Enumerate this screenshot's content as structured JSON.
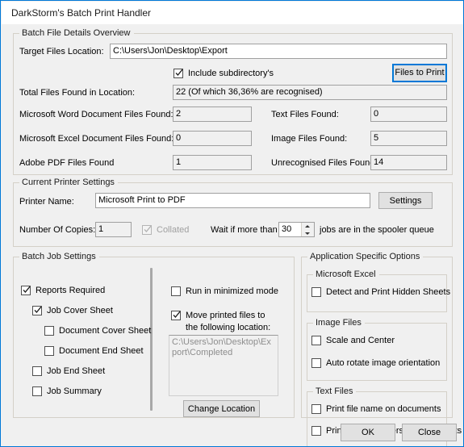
{
  "window": {
    "title": "DarkStorm's Batch Print Handler",
    "accent_color": "#0078d7",
    "surface_color": "#f0f0f0"
  },
  "batch_file_details": {
    "legend": "Batch File Details Overview",
    "target_location_label": "Target Files Location:",
    "target_location_value": "C:\\Users\\Jon\\Desktop\\Export",
    "include_subdirs_label": "Include subdirectory's",
    "include_subdirs_checked": true,
    "files_to_print_label": "Files to Print",
    "total_found_label": "Total Files Found in Location:",
    "total_found_value": "22 (Of which 36,36% are recognised)",
    "counts": [
      {
        "label": "Microsoft Word Document Files Found:",
        "value": "2"
      },
      {
        "label": "Text Files Found:",
        "value": "0"
      },
      {
        "label": "Microsoft Excel Document Files Found:",
        "value": "0"
      },
      {
        "label": "Image Files Found:",
        "value": "5"
      },
      {
        "label": "Adobe PDF Files Found",
        "value": "1"
      },
      {
        "label": "Unrecognised Files Found:",
        "value": "14"
      }
    ]
  },
  "printer_settings": {
    "legend": "Current Printer Settings",
    "printer_name_label": "Printer Name:",
    "printer_name_value": "Microsoft Print to PDF",
    "settings_button_label": "Settings",
    "copies_label": "Number Of Copies:",
    "copies_value": "1",
    "collated_label": "Collated",
    "collated_checked": true,
    "collated_enabled": false,
    "wait_prefix_label": "Wait if more than",
    "wait_value": "30",
    "wait_suffix_label": "jobs are in the spooler queue"
  },
  "batch_job_settings": {
    "legend": "Batch Job Settings",
    "left_options": [
      {
        "label": "Reports Required",
        "checked": true,
        "indent": 0
      },
      {
        "label": "Job Cover Sheet",
        "checked": true,
        "indent": 1
      },
      {
        "label": "Document Cover Sheet",
        "checked": false,
        "indent": 2
      },
      {
        "label": "Document End Sheet",
        "checked": false,
        "indent": 2
      },
      {
        "label": "Job End Sheet",
        "checked": false,
        "indent": 1
      },
      {
        "label": "Job Summary",
        "checked": false,
        "indent": 1
      }
    ],
    "run_minimized_label": "Run in minimized mode",
    "run_minimized_checked": false,
    "move_files_label_line1": "Move printed files to",
    "move_files_label_line2": "the following location:",
    "move_files_checked": true,
    "move_destination_value": "C:\\Users\\Jon\\Desktop\\Export\\Completed",
    "change_location_label": "Change Location"
  },
  "application_options": {
    "legend": "Application Specific Options",
    "excel": {
      "legend": "Microsoft Excel",
      "options": [
        {
          "label": "Detect and Print Hidden Sheets",
          "checked": false
        }
      ]
    },
    "image": {
      "legend": "Image Files",
      "options": [
        {
          "label": "Scale and Center",
          "checked": false
        },
        {
          "label": "Auto rotate image orientation",
          "checked": false
        }
      ]
    },
    "text": {
      "legend": "Text Files",
      "options": [
        {
          "label": "Print file name on documents",
          "checked": false
        },
        {
          "label": "Print page numbers on documents",
          "checked": false
        }
      ]
    }
  },
  "footer": {
    "ok_label": "OK",
    "close_label": "Close"
  }
}
